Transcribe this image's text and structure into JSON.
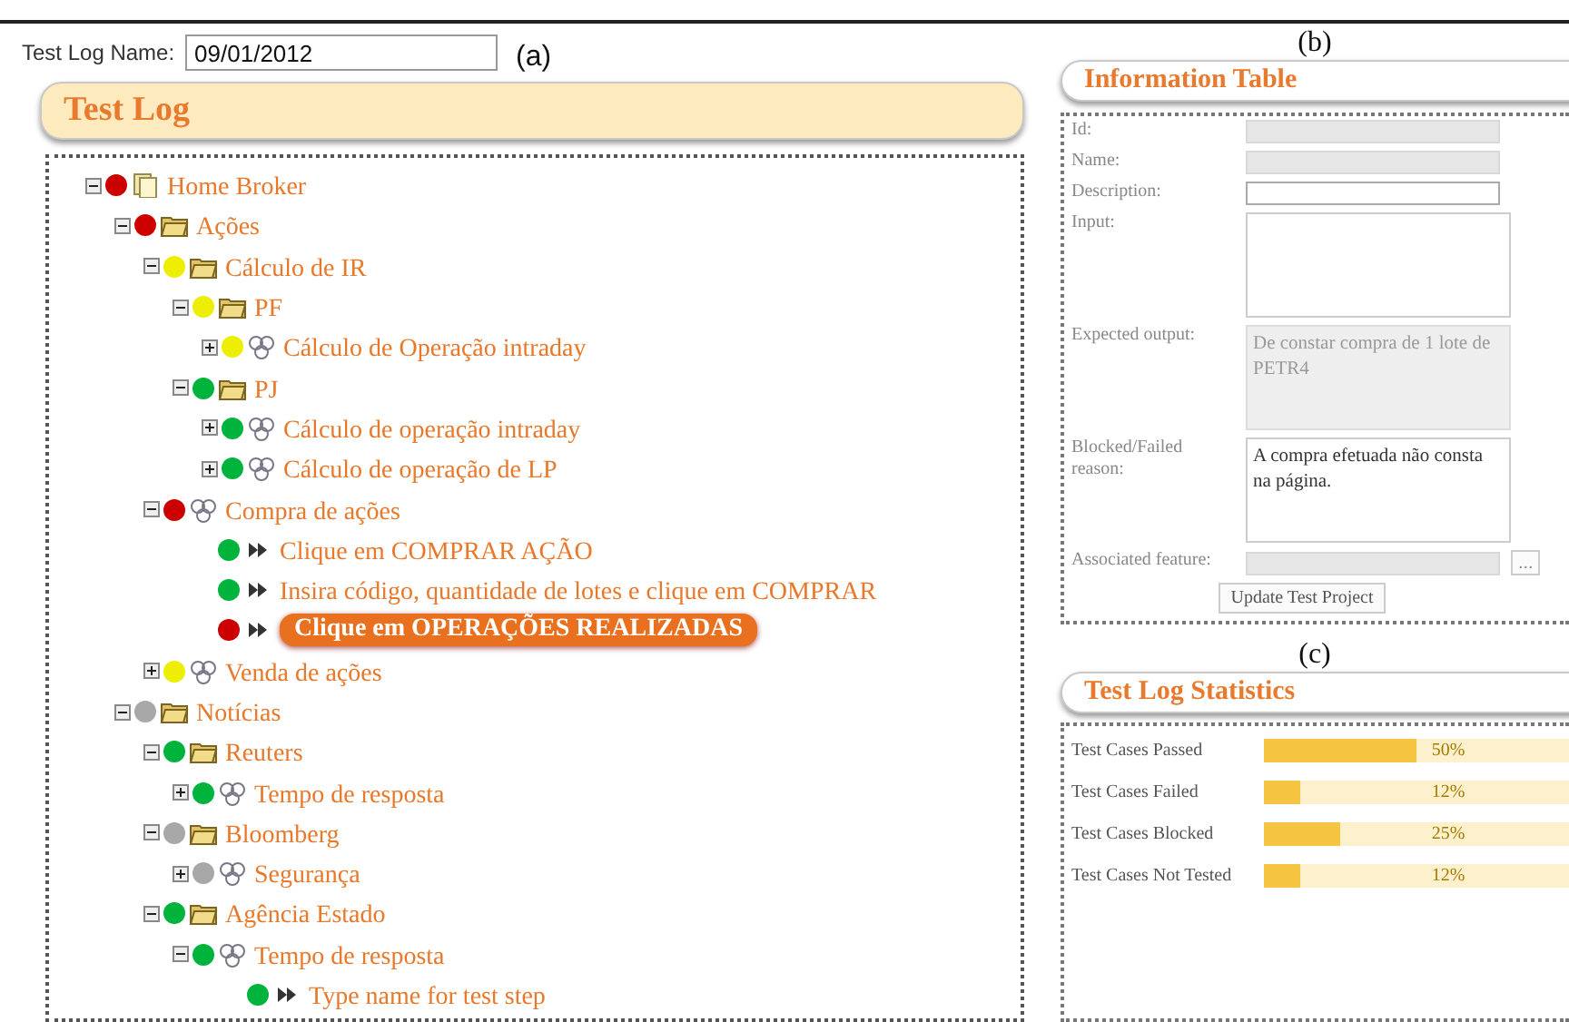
{
  "test_log_name": {
    "label": "Test Log Name:",
    "value": "09/01/2012"
  },
  "panel_labels": [
    "(a)",
    "(b)",
    "(c)"
  ],
  "test_log": {
    "title": "Test Log",
    "tree": [
      {
        "label": "Home Broker",
        "kind": "project",
        "color": "#cc0000",
        "expanded": true,
        "selected": false,
        "children": [
          {
            "label": "Ações",
            "kind": "folder",
            "color": "#cc0000",
            "expanded": true,
            "selected": false,
            "children": [
              {
                "label": "Cálculo de IR",
                "kind": "folder",
                "color": "#eeee00",
                "expanded": true,
                "selected": false,
                "children": [
                  {
                    "label": "PF",
                    "kind": "folder",
                    "color": "#eeee00",
                    "expanded": true,
                    "selected": false,
                    "children": [
                      {
                        "label": "Cálculo de Operação intraday",
                        "kind": "testcase",
                        "color": "#eeee00",
                        "expanded": false,
                        "selected": false
                      }
                    ]
                  },
                  {
                    "label": "PJ",
                    "kind": "folder",
                    "color": "#00b33c",
                    "expanded": true,
                    "selected": false,
                    "children": [
                      {
                        "label": "Cálculo de operação intraday",
                        "kind": "testcase",
                        "color": "#00b33c",
                        "expanded": false,
                        "selected": false
                      },
                      {
                        "label": "Cálculo de operação de LP",
                        "kind": "testcase",
                        "color": "#00b33c",
                        "expanded": false,
                        "selected": false
                      }
                    ]
                  }
                ]
              },
              {
                "label": "Compra de ações",
                "kind": "testcase",
                "color": "#cc0000",
                "expanded": true,
                "selected": false,
                "children": [
                  {
                    "label": "Clique em COMPRAR AÇÃO",
                    "kind": "step",
                    "color": "#00b33c",
                    "selected": false
                  },
                  {
                    "label": "Insira código, quantidade de lotes e clique em COMPRAR",
                    "kind": "step",
                    "color": "#00b33c",
                    "selected": false
                  },
                  {
                    "label": "Clique em OPERAÇÕES REALIZADAS",
                    "kind": "step",
                    "color": "#cc0000",
                    "selected": true
                  }
                ]
              },
              {
                "label": "Venda de ações",
                "kind": "testcase",
                "color": "#eeee00",
                "expanded": false,
                "selected": false
              }
            ]
          },
          {
            "label": "Notícias",
            "kind": "folder",
            "color": "#a8a8a8",
            "expanded": true,
            "selected": false,
            "children": [
              {
                "label": "Reuters",
                "kind": "folder",
                "color": "#00b33c",
                "expanded": true,
                "selected": false,
                "children": [
                  {
                    "label": "Tempo de resposta",
                    "kind": "testcase",
                    "color": "#00b33c",
                    "expanded": false,
                    "selected": false
                  }
                ]
              },
              {
                "label": "Bloomberg",
                "kind": "folder",
                "color": "#a8a8a8",
                "expanded": true,
                "selected": false,
                "children": [
                  {
                    "label": "Segurança",
                    "kind": "testcase",
                    "color": "#a8a8a8",
                    "expanded": false,
                    "selected": false
                  }
                ]
              },
              {
                "label": "Agência Estado",
                "kind": "folder",
                "color": "#00b33c",
                "expanded": true,
                "selected": false,
                "children": [
                  {
                    "label": "Tempo de resposta",
                    "kind": "testcase",
                    "color": "#00b33c",
                    "expanded": true,
                    "selected": false,
                    "children": [
                      {
                        "label": "Type name for test step",
                        "kind": "step",
                        "color": "#00b33c",
                        "selected": false
                      }
                    ]
                  }
                ]
              }
            ]
          }
        ]
      }
    ]
  },
  "information_table": {
    "title": "Information Table",
    "fields": [
      {
        "label": "Id:",
        "kind": "input",
        "disabled": true
      },
      {
        "label": "Name:",
        "kind": "input",
        "disabled": true
      },
      {
        "label": "Description:",
        "kind": "input",
        "disabled": false
      },
      {
        "label": "Input:",
        "kind": "textarea",
        "disabled": false
      },
      {
        "label": "Expected output:",
        "kind": "textarea",
        "disabled": true,
        "value": "De constar compra de 1 lote de PETR4"
      },
      {
        "label": "Blocked/Failed reason:",
        "kind": "textarea",
        "disabled": false,
        "value": "A compra efetuada não consta na página."
      },
      {
        "label": "Associated feature:",
        "kind": "lookup",
        "disabled": true,
        "button_label": "..."
      }
    ],
    "button": "Update Test Project"
  },
  "statistics": {
    "title": "Test Log Statistics",
    "rows": [
      {
        "label": "Test Cases Passed",
        "level": 0.5,
        "reading": "50%"
      },
      {
        "label": "Test Cases Failed",
        "level": 0.12,
        "reading": "12%"
      },
      {
        "label": "Test Cases Blocked",
        "level": 0.25,
        "reading": "25%"
      },
      {
        "label": "Test Cases Not Tested",
        "level": 0.12,
        "reading": "12%"
      }
    ]
  }
}
